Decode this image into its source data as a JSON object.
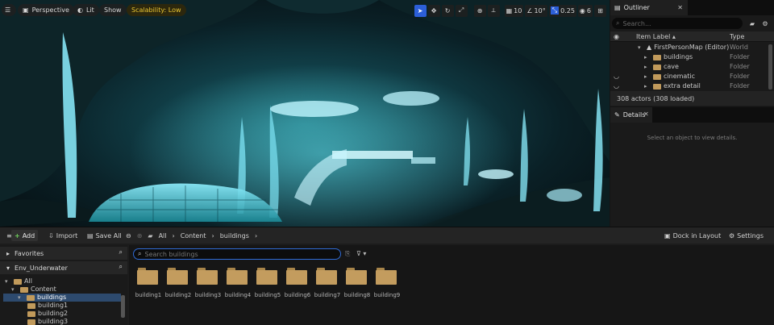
{
  "viewport": {
    "perspective_label": "Perspective",
    "lit_label": "Lit",
    "show_label": "Show",
    "scalability_label": "Scalability: Low",
    "grid_snap_value": "10",
    "rotation_snap_value": "10°",
    "scale_snap_value": "0.25",
    "camera_speed_value": "6"
  },
  "outliner": {
    "tab_label": "Outliner",
    "search_placeholder": "Search...",
    "col_item_label": "Item Label ▴",
    "col_type": "Type",
    "rows": [
      {
        "label": "FirstPersonMap (Editor)",
        "type": "World"
      },
      {
        "label": "buildings",
        "type": "Folder"
      },
      {
        "label": "cave",
        "type": "Folder"
      },
      {
        "label": "cinematic",
        "type": "Folder"
      },
      {
        "label": "extra detail",
        "type": "Folder"
      }
    ],
    "status": "308 actors (308 loaded)"
  },
  "details": {
    "tab_label": "Details",
    "empty_message": "Select an object to view details."
  },
  "content_browser": {
    "add_label": "Add",
    "import_label": "Import",
    "save_all_label": "Save All",
    "breadcrumb": [
      "All",
      "Content",
      "buildings"
    ],
    "dock_label": "Dock in Layout",
    "settings_label": "Settings",
    "favorites_label": "Favorites",
    "project_label": "Env_Underwater",
    "search_placeholder": "Search buildings",
    "tree": [
      {
        "label": "All"
      },
      {
        "label": "Content"
      },
      {
        "label": "buildings"
      },
      {
        "label": "building1"
      },
      {
        "label": "building2"
      },
      {
        "label": "building3"
      }
    ],
    "folders": [
      "building1",
      "building2",
      "building3",
      "building4",
      "building5",
      "building6",
      "building7",
      "building8",
      "building9"
    ]
  },
  "colors": {
    "selection_blue": "#2c5fd8",
    "folder": "#c39c5e",
    "scalability_yellow": "#e8c532"
  }
}
